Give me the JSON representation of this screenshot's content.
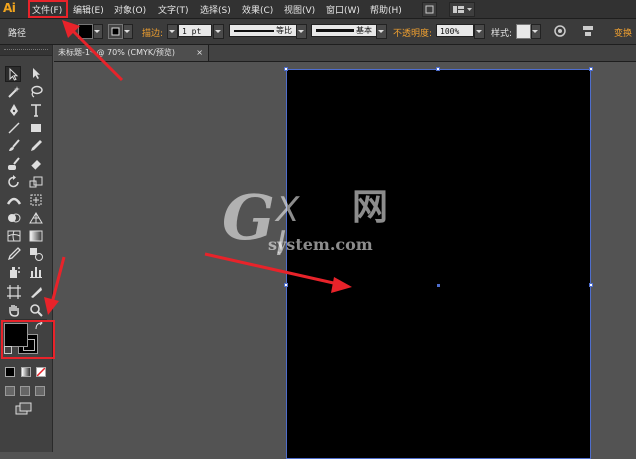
{
  "app": {
    "logo": "Ai"
  },
  "menubar": {
    "items": [
      "文件(F)",
      "编辑(E)",
      "对象(O)",
      "文字(T)",
      "选择(S)",
      "效果(C)",
      "视图(V)",
      "窗口(W)",
      "帮助(H)"
    ]
  },
  "control_bar": {
    "object_type": "路径",
    "stroke_label": "描边:",
    "stroke_weight": "1 pt",
    "stroke_profile": "等比",
    "brush_definition": "基本",
    "opacity_label": "不透明度:",
    "opacity_value": "100%",
    "style_label": "样式:",
    "transform_label": "变换",
    "fill_color": "#000000",
    "accent_label_color": "#f0a030"
  },
  "document": {
    "tab_title": "未标题-1* @ 70% (CMYK/预览)",
    "close_glyph": "×",
    "artboard_fill": "#000000",
    "selection_color": "#4f6ecd"
  },
  "toolbox": {
    "fill_color": "#000000",
    "stroke_color": "#000000"
  },
  "watermark": {
    "mark": "G",
    "mark_rest": "X I",
    "net": "网",
    "site": "system.com"
  },
  "annotations": {
    "highlight_color": "#e8232a"
  }
}
